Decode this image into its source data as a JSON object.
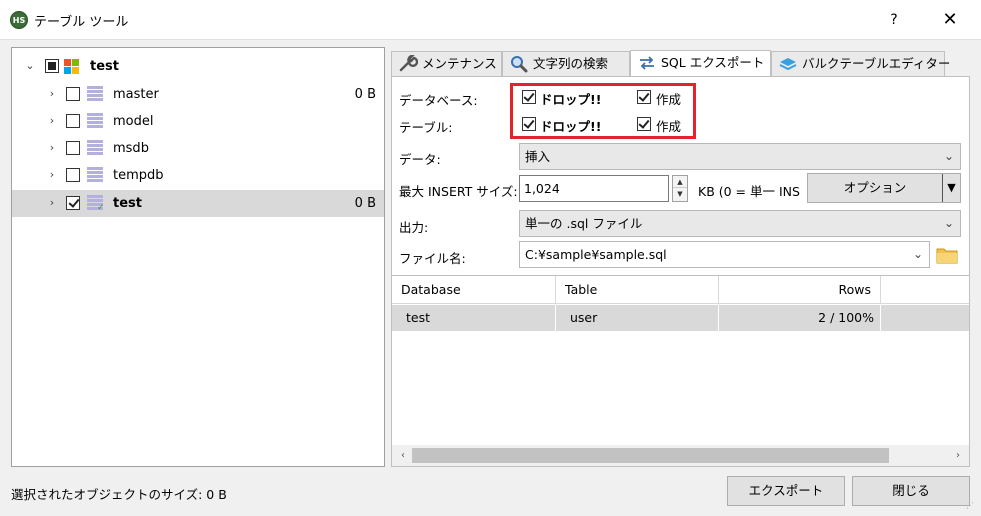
{
  "window": {
    "title": "テーブル ツール",
    "app_icon_text": "HS",
    "help_label": "?",
    "close_label": "✕"
  },
  "tree": {
    "root": {
      "label": "test",
      "checked": "partial"
    },
    "items": [
      {
        "label": "master",
        "size": "0 B",
        "checked": false
      },
      {
        "label": "model",
        "size": "",
        "checked": false
      },
      {
        "label": "msdb",
        "size": "",
        "checked": false
      },
      {
        "label": "tempdb",
        "size": "",
        "checked": false
      },
      {
        "label": "test",
        "size": "0 B",
        "checked": true,
        "selected": true
      }
    ]
  },
  "tabs": [
    {
      "label": "メンテナンス",
      "icon": "wrench-icon"
    },
    {
      "label": "文字列の検索",
      "icon": "magnifier-icon"
    },
    {
      "label": "SQL エクスポート",
      "icon": "export-arrows-icon",
      "active": true
    },
    {
      "label": "バルクテーブルエディター",
      "icon": "table-stack-icon"
    }
  ],
  "form": {
    "database_label": "データベース:",
    "table_label": "テーブル:",
    "drop_label": "ドロップ!!",
    "create_label": "作成",
    "data_label": "データ:",
    "data_value": "挿入",
    "max_insert_label": "最大 INSERT サイズ:",
    "max_insert_value": "1,024",
    "kb_note": "KB (0 = 単一 INS",
    "options_button": "オプション",
    "output_label": "出力:",
    "output_value": "単一の .sql ファイル",
    "filename_label": "ファイル名:",
    "filename_value": "C:¥sample¥sample.sql"
  },
  "grid": {
    "columns": [
      "Database",
      "Table",
      "Rows"
    ],
    "rows": [
      {
        "database": "test",
        "table": "user",
        "rows": "2 / 100%"
      }
    ]
  },
  "footer": {
    "status": "選択されたオブジェクトのサイズ: 0 B",
    "export_button": "エクスポート",
    "close_button": "閉じる"
  },
  "colors": {
    "highlight_border": "#e3242b",
    "selection": "#d9d9d9",
    "db_icon": "#b3b0dd"
  }
}
